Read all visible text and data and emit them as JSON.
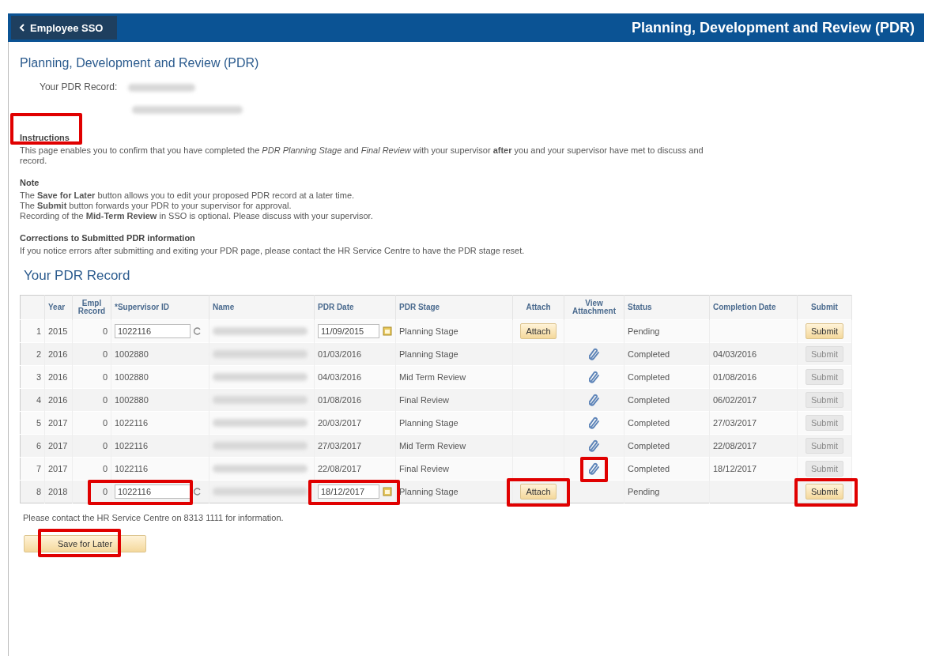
{
  "header": {
    "back_label": "Employee SSO",
    "title": "Planning, Development and Review (PDR)"
  },
  "page_title": "Planning, Development and Review (PDR)",
  "record_label": "Your PDR Record:",
  "sections": [
    {
      "heading": "Instructions",
      "heading_highlighted": true,
      "lines": [
        "This page enables you to confirm that you have completed the *PDR Planning Stage* and *Final Review* with your supervisor **after** you and your supervisor have met to discuss and record."
      ]
    },
    {
      "heading": "Note",
      "heading_highlighted": false,
      "lines": [
        "The **Save for Later** button allows you to edit your proposed PDR record at a later time.",
        "The **Submit** button forwards your PDR to your supervisor for approval.",
        "Recording of the **Mid-Term Review** in SSO is optional. Please discuss with your supervisor."
      ]
    },
    {
      "heading": "Corrections to Submitted PDR information",
      "heading_highlighted": false,
      "lines": [
        "If you notice errors after submitting and exiting your PDR page, please contact the HR Service Centre to have the PDR stage reset."
      ]
    }
  ],
  "table_title": "Your PDR Record",
  "columns": [
    "Year",
    "Empl Record",
    "*Supervisor ID",
    "Name",
    "PDR Date",
    "PDR Stage",
    "Attach",
    "View Attachment",
    "Status",
    "Completion Date",
    "Submit"
  ],
  "rows": [
    {
      "num": "1",
      "year": "2015",
      "empl": "0",
      "supervisor_id": "1022116",
      "editable": true,
      "pdr_date": "11/09/2015",
      "stage": "Planning Stage",
      "attach": "Attach",
      "has_attachment": false,
      "status": "Pending",
      "completion_date": "",
      "submit": "Submit",
      "submit_disabled": false
    },
    {
      "num": "2",
      "year": "2016",
      "empl": "0",
      "supervisor_id": "1002880",
      "editable": false,
      "pdr_date": "01/03/2016",
      "stage": "Planning Stage",
      "has_attachment": true,
      "status": "Completed",
      "completion_date": "04/03/2016",
      "submit": "Submit",
      "submit_disabled": true
    },
    {
      "num": "3",
      "year": "2016",
      "empl": "0",
      "supervisor_id": "1002880",
      "editable": false,
      "pdr_date": "04/03/2016",
      "stage": "Mid Term Review",
      "has_attachment": true,
      "status": "Completed",
      "completion_date": "01/08/2016",
      "submit": "Submit",
      "submit_disabled": true
    },
    {
      "num": "4",
      "year": "2016",
      "empl": "0",
      "supervisor_id": "1002880",
      "editable": false,
      "pdr_date": "01/08/2016",
      "stage": "Final Review",
      "has_attachment": true,
      "status": "Completed",
      "completion_date": "06/02/2017",
      "submit": "Submit",
      "submit_disabled": true
    },
    {
      "num": "5",
      "year": "2017",
      "empl": "0",
      "supervisor_id": "1022116",
      "editable": false,
      "pdr_date": "20/03/2017",
      "stage": "Planning Stage",
      "has_attachment": true,
      "status": "Completed",
      "completion_date": "27/03/2017",
      "submit": "Submit",
      "submit_disabled": true
    },
    {
      "num": "6",
      "year": "2017",
      "empl": "0",
      "supervisor_id": "1022116",
      "editable": false,
      "pdr_date": "27/03/2017",
      "stage": "Mid Term Review",
      "has_attachment": true,
      "status": "Completed",
      "completion_date": "22/08/2017",
      "submit": "Submit",
      "submit_disabled": true
    },
    {
      "num": "7",
      "year": "2017",
      "empl": "0",
      "supervisor_id": "1022116",
      "editable": false,
      "pdr_date": "22/08/2017",
      "stage": "Final Review",
      "has_attachment": true,
      "attachment_highlighted": true,
      "status": "Completed",
      "completion_date": "18/12/2017",
      "submit": "Submit",
      "submit_disabled": true
    },
    {
      "num": "8",
      "year": "2018",
      "empl": "0",
      "supervisor_id": "1022116",
      "supervisor_highlighted": true,
      "editable": true,
      "pdr_date": "18/12/2017",
      "date_highlighted": true,
      "stage": "Planning Stage",
      "attach": "Attach",
      "attach_highlighted": true,
      "has_attachment": false,
      "status": "Pending",
      "completion_date": "",
      "submit": "Submit",
      "submit_disabled": false,
      "submit_highlighted": true
    }
  ],
  "footer_note": "Please contact the HR Service Centre on 8313 1111 for information.",
  "save_button": {
    "label": "Save for Later",
    "highlighted": true
  }
}
